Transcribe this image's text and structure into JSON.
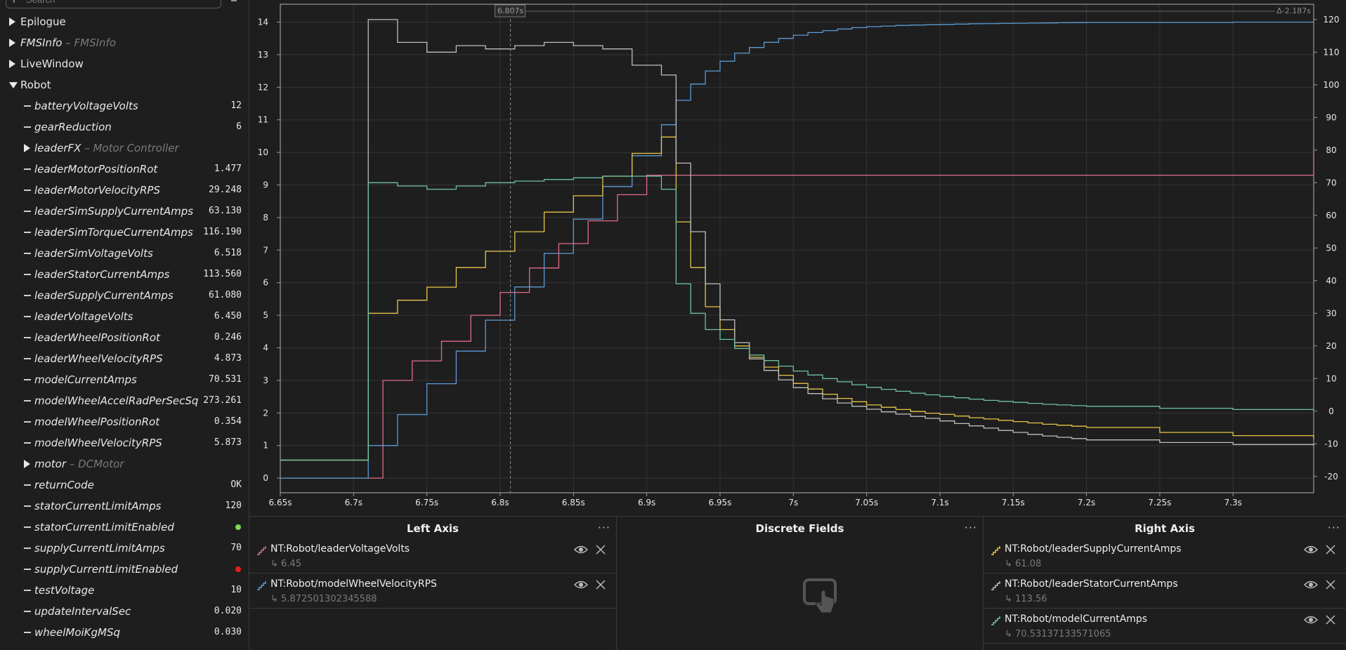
{
  "sidebar": {
    "search_placeholder": "Search",
    "tree": [
      {
        "label": "Epilogue",
        "sub": "",
        "value": "",
        "kind": "collapsed",
        "level": 0,
        "italic": false
      },
      {
        "label": "FMSInfo",
        "sub": " – FMSInfo",
        "value": "",
        "kind": "collapsed",
        "level": 0,
        "italic": true
      },
      {
        "label": "LiveWindow",
        "sub": "",
        "value": "",
        "kind": "collapsed",
        "level": 0,
        "italic": false
      },
      {
        "label": "Robot",
        "sub": "",
        "value": "",
        "kind": "expanded",
        "level": 0,
        "italic": false
      },
      {
        "label": "batteryVoltageVolts",
        "sub": "",
        "value": "12",
        "kind": "leaf",
        "level": 1,
        "italic": true
      },
      {
        "label": "gearReduction",
        "sub": "",
        "value": "6",
        "kind": "leaf",
        "level": 1,
        "italic": true
      },
      {
        "label": "leaderFX",
        "sub": " – Motor Controller",
        "value": "",
        "kind": "collapsed",
        "level": 1,
        "italic": true
      },
      {
        "label": "leaderMotorPositionRot",
        "sub": "",
        "value": "1.477",
        "kind": "leaf",
        "level": 1,
        "italic": true
      },
      {
        "label": "leaderMotorVelocityRPS",
        "sub": "",
        "value": "29.248",
        "kind": "leaf",
        "level": 1,
        "italic": true
      },
      {
        "label": "leaderSimSupplyCurrentAmps",
        "sub": "",
        "value": "63.130",
        "kind": "leaf",
        "level": 1,
        "italic": true
      },
      {
        "label": "leaderSimTorqueCurrentAmps",
        "sub": "",
        "value": "116.190",
        "kind": "leaf",
        "level": 1,
        "italic": true
      },
      {
        "label": "leaderSimVoltageVolts",
        "sub": "",
        "value": "6.518",
        "kind": "leaf",
        "level": 1,
        "italic": true
      },
      {
        "label": "leaderStatorCurrentAmps",
        "sub": "",
        "value": "113.560",
        "kind": "leaf",
        "level": 1,
        "italic": true
      },
      {
        "label": "leaderSupplyCurrentAmps",
        "sub": "",
        "value": "61.080",
        "kind": "leaf",
        "level": 1,
        "italic": true
      },
      {
        "label": "leaderVoltageVolts",
        "sub": "",
        "value": "6.450",
        "kind": "leaf",
        "level": 1,
        "italic": true
      },
      {
        "label": "leaderWheelPositionRot",
        "sub": "",
        "value": "0.246",
        "kind": "leaf",
        "level": 1,
        "italic": true
      },
      {
        "label": "leaderWheelVelocityRPS",
        "sub": "",
        "value": "4.873",
        "kind": "leaf",
        "level": 1,
        "italic": true
      },
      {
        "label": "modelCurrentAmps",
        "sub": "",
        "value": "70.531",
        "kind": "leaf",
        "level": 1,
        "italic": true
      },
      {
        "label": "modelWheelAccelRadPerSecSq",
        "sub": "",
        "value": "273.261",
        "kind": "leaf",
        "level": 1,
        "italic": true
      },
      {
        "label": "modelWheelPositionRot",
        "sub": "",
        "value": "0.354",
        "kind": "leaf",
        "level": 1,
        "italic": true
      },
      {
        "label": "modelWheelVelocityRPS",
        "sub": "",
        "value": "5.873",
        "kind": "leaf",
        "level": 1,
        "italic": true
      },
      {
        "label": "motor",
        "sub": " – DCMotor",
        "value": "",
        "kind": "collapsed",
        "level": 1,
        "italic": true
      },
      {
        "label": "returnCode",
        "sub": "",
        "value": "OK",
        "kind": "leaf",
        "level": 1,
        "italic": true
      },
      {
        "label": "statorCurrentLimitAmps",
        "sub": "",
        "value": "120",
        "kind": "leaf",
        "level": 1,
        "italic": true
      },
      {
        "label": "statorCurrentLimitEnabled",
        "sub": "",
        "value": "",
        "kind": "leaf-bool",
        "bool": true,
        "level": 1,
        "italic": true
      },
      {
        "label": "supplyCurrentLimitAmps",
        "sub": "",
        "value": "70",
        "kind": "leaf",
        "level": 1,
        "italic": true
      },
      {
        "label": "supplyCurrentLimitEnabled",
        "sub": "",
        "value": "",
        "kind": "leaf-bool",
        "bool": false,
        "level": 1,
        "italic": true
      },
      {
        "label": "testVoltage",
        "sub": "",
        "value": "10",
        "kind": "leaf",
        "level": 1,
        "italic": true
      },
      {
        "label": "updateIntervalSec",
        "sub": "",
        "value": "0.020",
        "kind": "leaf",
        "level": 1,
        "italic": true
      },
      {
        "label": "wheelMoiKgMSq",
        "sub": "",
        "value": "0.030",
        "kind": "leaf",
        "level": 1,
        "italic": true
      }
    ],
    "colors": {
      "true": "#7ed957",
      "false": "#e02020"
    }
  },
  "chart_data": {
    "type": "line",
    "cursor_label": "6.807s",
    "delta_label": "Δ-2.187s",
    "cursor_x": 6.807,
    "xlim": [
      6.65,
      7.355
    ],
    "x_ticks": [
      "6.65s",
      "6.7s",
      "6.75s",
      "6.8s",
      "6.85s",
      "6.9s",
      "6.95s",
      "7s",
      "7.05s",
      "7.1s",
      "7.15s",
      "7.2s",
      "7.25s",
      "7.3s"
    ],
    "x_tick_values": [
      6.65,
      6.7,
      6.75,
      6.8,
      6.85,
      6.9,
      6.95,
      7.0,
      7.05,
      7.1,
      7.15,
      7.2,
      7.25,
      7.3
    ],
    "left_axis": {
      "ylim": [
        -0.45,
        14.55
      ],
      "ticks": [
        "0",
        "1",
        "2",
        "3",
        "4",
        "5",
        "6",
        "7",
        "8",
        "9",
        "10",
        "11",
        "12",
        "13",
        "14"
      ]
    },
    "right_axis": {
      "ylim": [
        -25,
        124.7
      ],
      "ticks": [
        "-20",
        "-10",
        "0",
        "10",
        "20",
        "30",
        "40",
        "50",
        "60",
        "70",
        "80",
        "90",
        "100",
        "110",
        "120"
      ],
      "tick_values": [
        -20,
        -10,
        0,
        10,
        20,
        30,
        40,
        50,
        60,
        70,
        80,
        90,
        100,
        110,
        120
      ]
    },
    "grid": true,
    "series": [
      {
        "name": "NT:Robot/leaderVoltageVolts",
        "axis": "left",
        "color": "#e06c8b",
        "x": [
          6.65,
          6.7,
          6.71,
          6.72,
          6.73,
          6.74,
          6.75,
          6.76,
          6.77,
          6.78,
          6.79,
          6.8,
          6.81,
          6.82,
          6.83,
          6.84,
          6.85,
          6.86,
          6.87,
          6.88,
          6.89,
          6.9,
          6.91,
          7.355
        ],
        "y": [
          0,
          0,
          0,
          3.0,
          3.0,
          3.6,
          3.6,
          4.2,
          4.2,
          5.0,
          5.0,
          5.7,
          5.7,
          6.45,
          6.45,
          7.2,
          7.2,
          7.9,
          7.9,
          8.7,
          8.7,
          9.3,
          9.3,
          10.0
        ]
      },
      {
        "name": "NT:Robot/modelWheelVelocityRPS",
        "axis": "left",
        "color": "#5b9bd5",
        "x": [
          6.65,
          6.7,
          6.71,
          6.72,
          6.73,
          6.74,
          6.75,
          6.76,
          6.77,
          6.78,
          6.79,
          6.8,
          6.81,
          6.82,
          6.83,
          6.84,
          6.85,
          6.86,
          6.87,
          6.88,
          6.89,
          6.9,
          6.91,
          6.92,
          6.93,
          6.94,
          6.95,
          6.96,
          6.97,
          6.98,
          6.99,
          7.0,
          7.01,
          7.02,
          7.03,
          7.04,
          7.05,
          7.06,
          7.07,
          7.08,
          7.09,
          7.1,
          7.11,
          7.12,
          7.13,
          7.14,
          7.15,
          7.16,
          7.17,
          7.18,
          7.19,
          7.2,
          7.25,
          7.3,
          7.355
        ],
        "y": [
          0,
          0,
          1.0,
          1.0,
          1.95,
          1.95,
          2.9,
          2.9,
          3.9,
          3.9,
          4.85,
          4.85,
          5.87,
          5.87,
          6.9,
          6.9,
          7.95,
          7.95,
          8.95,
          8.95,
          9.9,
          9.9,
          10.85,
          11.6,
          12.1,
          12.5,
          12.8,
          13.05,
          13.22,
          13.38,
          13.5,
          13.6,
          13.68,
          13.74,
          13.79,
          13.83,
          13.86,
          13.88,
          13.9,
          13.91,
          13.92,
          13.93,
          13.94,
          13.95,
          13.955,
          13.96,
          13.965,
          13.97,
          13.975,
          13.98,
          13.985,
          13.99,
          13.99,
          14.0,
          14.0
        ]
      },
      {
        "name": "NT:Robot/leaderSupplyCurrentAmps",
        "axis": "right",
        "color": "#e8c547",
        "x": [
          6.65,
          6.7,
          6.71,
          6.72,
          6.73,
          6.74,
          6.75,
          6.76,
          6.77,
          6.78,
          6.79,
          6.8,
          6.81,
          6.82,
          6.83,
          6.84,
          6.85,
          6.86,
          6.87,
          6.88,
          6.89,
          6.9,
          6.91,
          6.92,
          6.93,
          6.94,
          6.95,
          6.96,
          6.97,
          6.98,
          6.99,
          7.0,
          7.01,
          7.02,
          7.03,
          7.04,
          7.05,
          7.06,
          7.07,
          7.08,
          7.09,
          7.1,
          7.11,
          7.12,
          7.13,
          7.14,
          7.15,
          7.16,
          7.17,
          7.18,
          7.19,
          7.2,
          7.25,
          7.3,
          7.355
        ],
        "y": [
          -15,
          -15,
          30,
          30,
          34,
          34,
          38,
          38,
          44,
          44,
          49,
          49,
          55,
          55,
          61,
          61,
          66,
          66,
          72,
          72,
          79,
          79,
          84,
          58,
          44,
          32,
          25,
          20,
          16.5,
          13.5,
          11,
          8.5,
          6.8,
          5.2,
          3.9,
          2.9,
          1.9,
          1.2,
          0.5,
          -0.1,
          -0.6,
          -1.0,
          -1.5,
          -2.0,
          -2.4,
          -2.8,
          -3.2,
          -3.6,
          -4.0,
          -4.3,
          -4.6,
          -5.0,
          -6.5,
          -7.5,
          -8.5
        ]
      },
      {
        "name": "NT:Robot/leaderStatorCurrentAmps",
        "axis": "right",
        "color": "#bfbfbf",
        "x": [
          6.65,
          6.7,
          6.71,
          6.72,
          6.73,
          6.74,
          6.75,
          6.76,
          6.77,
          6.78,
          6.79,
          6.8,
          6.81,
          6.82,
          6.83,
          6.84,
          6.85,
          6.86,
          6.87,
          6.88,
          6.89,
          6.9,
          6.91,
          6.92,
          6.93,
          6.94,
          6.95,
          6.96,
          6.97,
          6.98,
          6.99,
          7.0,
          7.01,
          7.02,
          7.03,
          7.04,
          7.05,
          7.06,
          7.07,
          7.08,
          7.09,
          7.1,
          7.11,
          7.12,
          7.13,
          7.14,
          7.15,
          7.16,
          7.17,
          7.18,
          7.19,
          7.2,
          7.25,
          7.3,
          7.355
        ],
        "y": [
          -15,
          -15,
          120,
          120,
          113,
          113,
          110,
          110,
          112,
          112,
          111,
          111,
          112,
          112,
          113,
          113,
          112,
          112,
          111,
          111,
          106,
          106,
          103,
          76,
          55,
          39,
          28,
          21,
          16,
          12.5,
          9.6,
          7.2,
          5.4,
          3.8,
          2.5,
          1.5,
          0.6,
          -0.2,
          -0.9,
          -1.6,
          -2.2,
          -3,
          -3.8,
          -4.5,
          -5.2,
          -5.9,
          -6.5,
          -7.1,
          -7.6,
          -8.0,
          -8.4,
          -8.8,
          -9.6,
          -10.2,
          -10.6
        ]
      },
      {
        "name": "NT:Robot/modelCurrentAmps",
        "axis": "right",
        "color": "#6fc2a0",
        "x": [
          6.65,
          6.7,
          6.71,
          6.72,
          6.73,
          6.74,
          6.75,
          6.76,
          6.77,
          6.78,
          6.79,
          6.8,
          6.81,
          6.82,
          6.83,
          6.84,
          6.85,
          6.86,
          6.87,
          6.88,
          6.89,
          6.9,
          6.91,
          6.92,
          6.93,
          6.94,
          6.95,
          6.96,
          6.97,
          6.98,
          6.99,
          7.0,
          7.01,
          7.02,
          7.03,
          7.04,
          7.05,
          7.06,
          7.07,
          7.08,
          7.09,
          7.1,
          7.11,
          7.12,
          7.13,
          7.14,
          7.15,
          7.16,
          7.17,
          7.18,
          7.19,
          7.2,
          7.25,
          7.3,
          7.355
        ],
        "y": [
          -15,
          -15,
          70,
          70,
          69,
          69,
          68,
          68,
          69,
          69,
          70,
          70,
          70.5,
          70.5,
          71,
          71,
          71.5,
          71.5,
          72,
          72,
          72,
          72,
          68,
          39,
          30,
          25,
          22,
          19.2,
          17.2,
          15.5,
          13.8,
          12.3,
          11.1,
          10,
          9,
          8.1,
          7.3,
          6.7,
          6.1,
          5.5,
          5.0,
          4.5,
          4.1,
          3.7,
          3.3,
          3.0,
          2.7,
          2.4,
          2.1,
          1.9,
          1.7,
          1.5,
          0.9,
          0.5,
          0.2
        ]
      }
    ]
  },
  "panels": {
    "left_axis": {
      "title": "Left Axis",
      "fields": [
        {
          "name": "NT:Robot/leaderVoltageVolts",
          "value": "6.45",
          "color": "#e06c8b"
        },
        {
          "name": "NT:Robot/modelWheelVelocityRPS",
          "value": "5.872501302345588",
          "color": "#5b9bd5"
        }
      ]
    },
    "discrete": {
      "title": "Discrete Fields"
    },
    "right_axis": {
      "title": "Right Axis",
      "fields": [
        {
          "name": "NT:Robot/leaderSupplyCurrentAmps",
          "value": "61.08",
          "color": "#e8c547"
        },
        {
          "name": "NT:Robot/leaderStatorCurrentAmps",
          "value": "113.56",
          "color": "#bfbfbf"
        },
        {
          "name": "NT:Robot/modelCurrentAmps",
          "value": "70.53137133571065",
          "color": "#6fc2a0"
        }
      ]
    },
    "menu_glyph": "···",
    "value_prefix": "↳ "
  }
}
